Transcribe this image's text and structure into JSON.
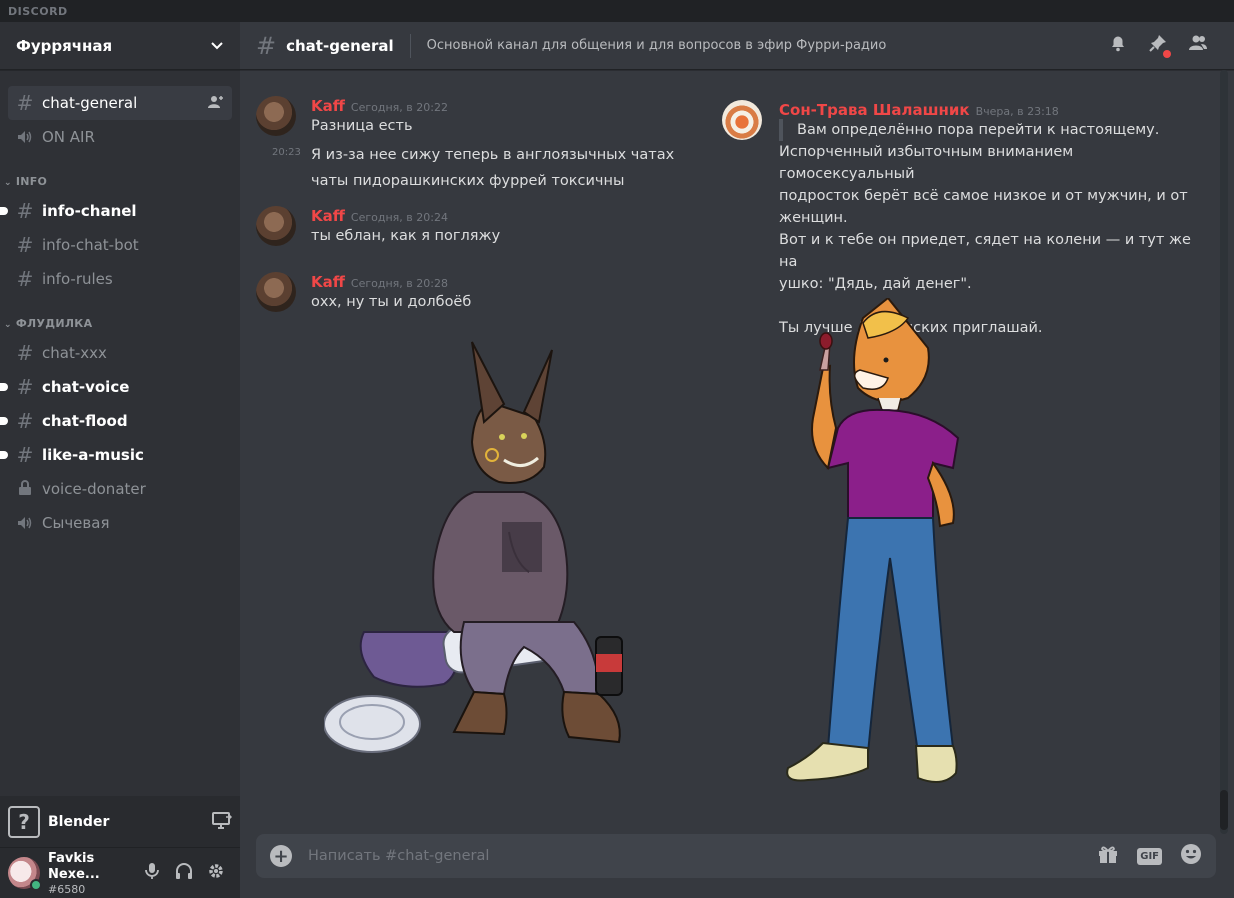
{
  "app": {
    "wordmark": "DISCORD"
  },
  "guild": {
    "name": "Фурря­чная"
  },
  "channels": {
    "top": [
      {
        "label": "chat-general",
        "icon": "hash",
        "state": "active"
      },
      {
        "label": "ON AIR",
        "icon": "speaker",
        "state": "normal"
      }
    ],
    "info": {
      "label": "INFO",
      "items": [
        {
          "label": "info-chanel",
          "icon": "hash",
          "state": "unread"
        },
        {
          "label": "info-chat-bot",
          "icon": "hash",
          "state": "normal"
        },
        {
          "label": "info-rules",
          "icon": "hash",
          "state": "normal"
        }
      ]
    },
    "flud": {
      "label": "ФЛУДИЛКА",
      "items": [
        {
          "label": "chat-xxx",
          "icon": "hash",
          "state": "normal"
        },
        {
          "label": "chat-voice",
          "icon": "hash",
          "state": "unread"
        },
        {
          "label": "chat-flood",
          "icon": "hash",
          "state": "unread"
        },
        {
          "label": "like-a-music",
          "icon": "hash",
          "state": "unread"
        },
        {
          "label": "voice-donater",
          "icon": "lock",
          "state": "normal"
        },
        {
          "label": "Сычевая",
          "icon": "speaker",
          "state": "normal"
        }
      ]
    }
  },
  "activity": {
    "game": "Blender",
    "icon": "?"
  },
  "user": {
    "name": "Favkis Nexe...",
    "tag": "#6580"
  },
  "header": {
    "channel": "chat-general",
    "topic": "Основной канал для общения и для вопросов в эфир Фурри-радио"
  },
  "messages_left": [
    {
      "author": "Kaff",
      "time": "Сегодня, в 20:22",
      "lines": [
        "Разница есть"
      ]
    },
    {
      "side_time": "20:23",
      "lines": [
        "Я из-за нее сижу теперь в англоязычных чатах",
        "чаты пидорашкинских фуррей токсичны"
      ]
    },
    {
      "author": "Kaff",
      "time": "Сегодня, в 20:24",
      "lines": [
        "ты еблан, как я погляжу"
      ]
    },
    {
      "author": "Kaff",
      "time": "Сегодня, в 20:28",
      "lines": [
        "охх, ну ты и долбоёб"
      ]
    }
  ],
  "message_right": {
    "author": "Сон-Трава Шалашник",
    "time": "Вчера, в 23:18",
    "quote": "Вам определённо пора перейти к настоящему.",
    "lines": [
      "Испорченный избыточным вниманием гомосексуальный",
      "подросток берёт всё самое низкое и от мужчин, и от",
      "женщин.",
      "Вот и к тебе он приедет, сядет на колени — и тут же на",
      "ушко: \"Дядь, дай денег\".",
      "",
      "Ты лучше Лиснянских приглашай."
    ]
  },
  "composer": {
    "placeholder": "Написать #chat-general",
    "gif": "GIF"
  },
  "colors": {
    "accent_red": "#f04747",
    "online": "#43b581"
  }
}
